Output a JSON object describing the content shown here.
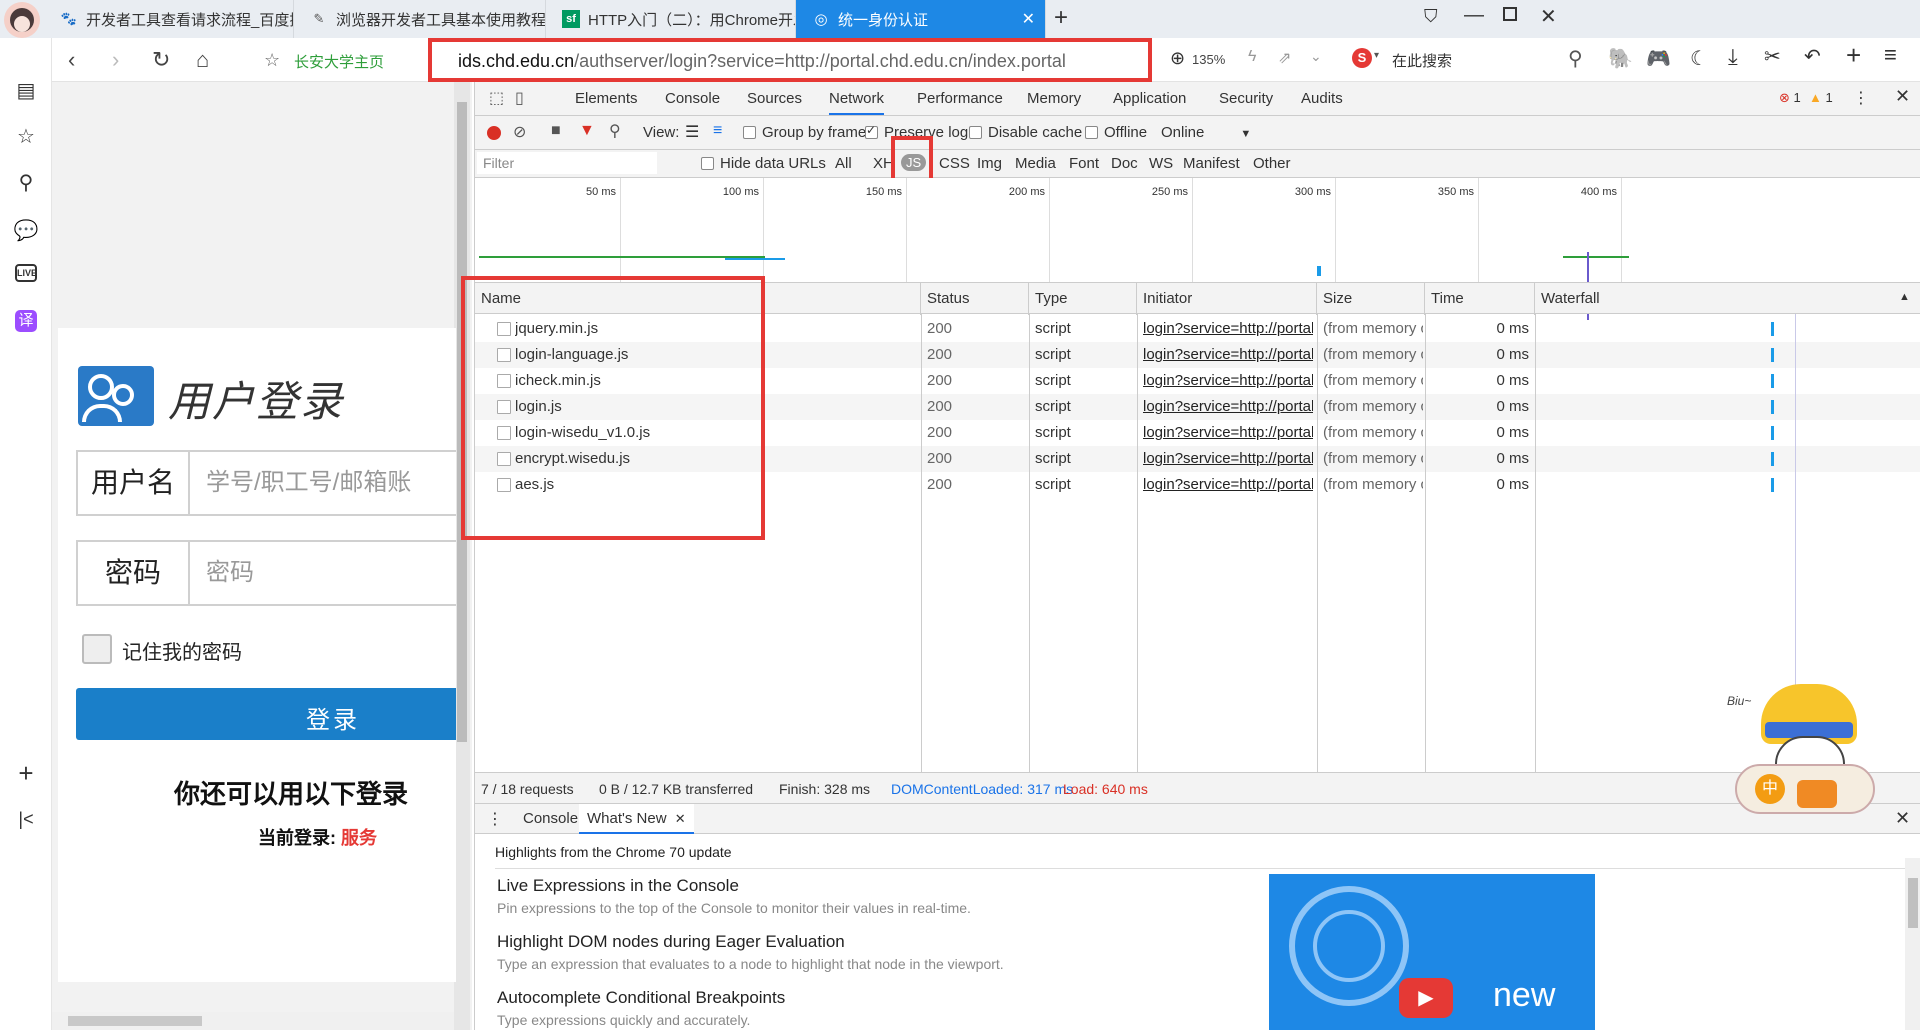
{
  "tabs": [
    {
      "label": "开发者工具查看请求流程_百度搜索",
      "icon": "baidu-paw-icon"
    },
    {
      "label": "浏览器开发者工具基本使用教程 - 墨",
      "icon": "feather-icon"
    },
    {
      "label": "HTTP入门（二）：用Chrome开发者",
      "icon": "sf-logo-icon"
    },
    {
      "label": "统一身份认证",
      "icon": "globe-icon"
    }
  ],
  "nav": {
    "bookmark_label": "长安大学主页",
    "url_host": "ids.chd.edu.cn",
    "url_path": "/authserver/login?service=http://portal.chd.edu.cn/index.portal",
    "zoom": "135%",
    "search_placeholder": "在此搜索"
  },
  "login": {
    "title": "用户登录",
    "username_label": "用户名",
    "username_placeholder": "学号/职工号/邮箱账",
    "password_label": "密码",
    "password_placeholder": "密码",
    "remember_label": "记住我的密码",
    "login_button": "登录",
    "alt_login": "你还可以用以下登录",
    "current_login_label": "当前登录:",
    "current_login_value": "服务"
  },
  "devtools": {
    "panels": [
      "Elements",
      "Console",
      "Sources",
      "Network",
      "Performance",
      "Memory",
      "Application",
      "Security",
      "Audits"
    ],
    "active_panel": "Network",
    "error_count": "1",
    "warning_count": "1",
    "toolbar": {
      "view_label": "View:",
      "group_by_frame": "Group by frame",
      "preserve_log": "Preserve log",
      "disable_cache": "Disable cache",
      "offline": "Offline",
      "online": "Online"
    },
    "filter": {
      "placeholder": "Filter",
      "hide_data_urls": "Hide data URLs",
      "types": [
        "All",
        "XHR",
        "JS",
        "CSS",
        "Img",
        "Media",
        "Font",
        "Doc",
        "WS",
        "Manifest",
        "Other"
      ],
      "active_type": "JS"
    },
    "timeline_ticks": [
      "50 ms",
      "100 ms",
      "150 ms",
      "200 ms",
      "250 ms",
      "300 ms",
      "350 ms",
      "400 ms"
    ],
    "columns": [
      "Name",
      "Status",
      "Type",
      "Initiator",
      "Size",
      "Time",
      "Waterfall"
    ],
    "rows": [
      {
        "name": "jquery.min.js",
        "status": "200",
        "type": "script",
        "initiator": "login?service=http://portal.ch...",
        "size": "(from memory c...",
        "time": "0 ms"
      },
      {
        "name": "login-language.js",
        "status": "200",
        "type": "script",
        "initiator": "login?service=http://portal.ch...",
        "size": "(from memory c...",
        "time": "0 ms"
      },
      {
        "name": "icheck.min.js",
        "status": "200",
        "type": "script",
        "initiator": "login?service=http://portal.ch...",
        "size": "(from memory c...",
        "time": "0 ms"
      },
      {
        "name": "login.js",
        "status": "200",
        "type": "script",
        "initiator": "login?service=http://portal.ch...",
        "size": "(from memory c...",
        "time": "0 ms"
      },
      {
        "name": "login-wisedu_v1.0.js",
        "status": "200",
        "type": "script",
        "initiator": "login?service=http://portal.ch...",
        "size": "(from memory c...",
        "time": "0 ms"
      },
      {
        "name": "encrypt.wisedu.js",
        "status": "200",
        "type": "script",
        "initiator": "login?service=http://portal.ch...",
        "size": "(from memory c...",
        "time": "0 ms"
      },
      {
        "name": "aes.js",
        "status": "200",
        "type": "script",
        "initiator": "login?service=http://portal.ch...",
        "size": "(from memory c...",
        "time": "0 ms"
      }
    ],
    "status": {
      "requests": "7 / 18 requests",
      "transferred": "0 B / 12.7 KB transferred",
      "finish": "Finish: 328 ms",
      "dcl": "DOMContentLoaded: 317 ms",
      "load": "Load: 640 ms"
    },
    "drawer": {
      "tabs": [
        "Console",
        "What's New"
      ],
      "active_tab": "What's New",
      "highlights": "Highlights from the Chrome 70 update",
      "items": [
        {
          "title": "Live Expressions in the Console",
          "desc": "Pin expressions to the top of the Console to monitor their values in real-time."
        },
        {
          "title": "Highlight DOM nodes during Eager Evaluation",
          "desc": "Type an expression that evaluates to a node to highlight that node in the viewport."
        },
        {
          "title": "Autocomplete Conditional Breakpoints",
          "desc": "Type expressions quickly and accurately."
        }
      ],
      "video_label": "new"
    },
    "mascot_text": "中",
    "mascot_biu": "Biu~"
  },
  "colors": {
    "accent": "#1e88e5",
    "highlight": "#e53935",
    "login_button": "#1a7fc9",
    "dcl": "#1a73e8",
    "load": "#d93025"
  }
}
